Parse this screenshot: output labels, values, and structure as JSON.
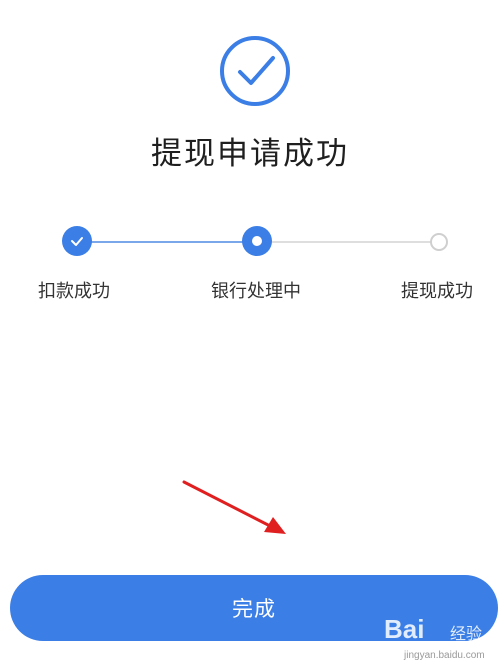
{
  "header": {
    "title": "提现申请成功",
    "icon": "check-circle-icon"
  },
  "progress": {
    "steps": [
      {
        "label": "扣款成功",
        "state": "done"
      },
      {
        "label": "银行处理中",
        "state": "current"
      },
      {
        "label": "提现成功",
        "state": "pending"
      }
    ]
  },
  "footer": {
    "done_label": "完成"
  },
  "watermark": {
    "brand": "Bai",
    "brand_cn": "经验",
    "url": "jingyan.baidu.com"
  },
  "colors": {
    "accent": "#3b7ee6",
    "pending": "#cfcfcf",
    "annotation_arrow": "#e02020"
  }
}
